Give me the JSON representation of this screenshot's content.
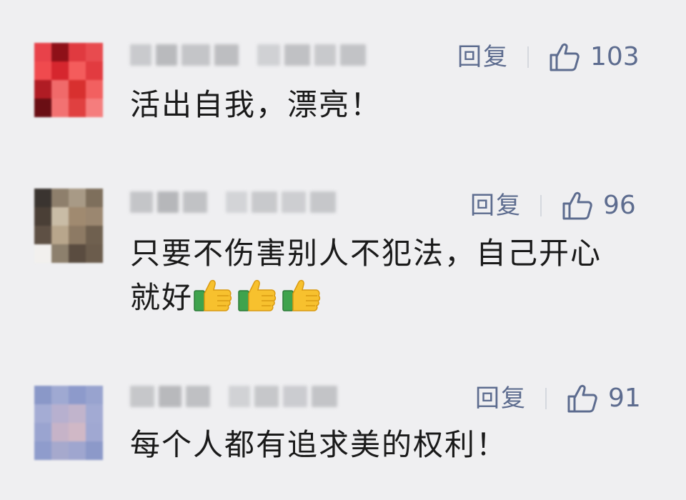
{
  "comments": [
    {
      "reply_label": "回复",
      "like_count": "103",
      "text": "活出自我，漂亮！",
      "emojis": []
    },
    {
      "reply_label": "回复",
      "like_count": "96",
      "text_line1": "只要不伤害别人不犯法，自己开心",
      "text_line2": "就好",
      "emojis": [
        "thumbs-up-emoji",
        "thumbs-up-emoji",
        "thumbs-up-emoji"
      ]
    },
    {
      "reply_label": "回复",
      "like_count": "91",
      "text": "每个人都有追求美的权利！",
      "emojis": []
    }
  ],
  "colors": {
    "background": "#efeff1",
    "action_text": "#5d6c8f",
    "comment_text": "#1a1a1a"
  },
  "icons": {
    "like": "thumbs-up-outline-icon",
    "emoji": "thumbs-up-emoji"
  }
}
